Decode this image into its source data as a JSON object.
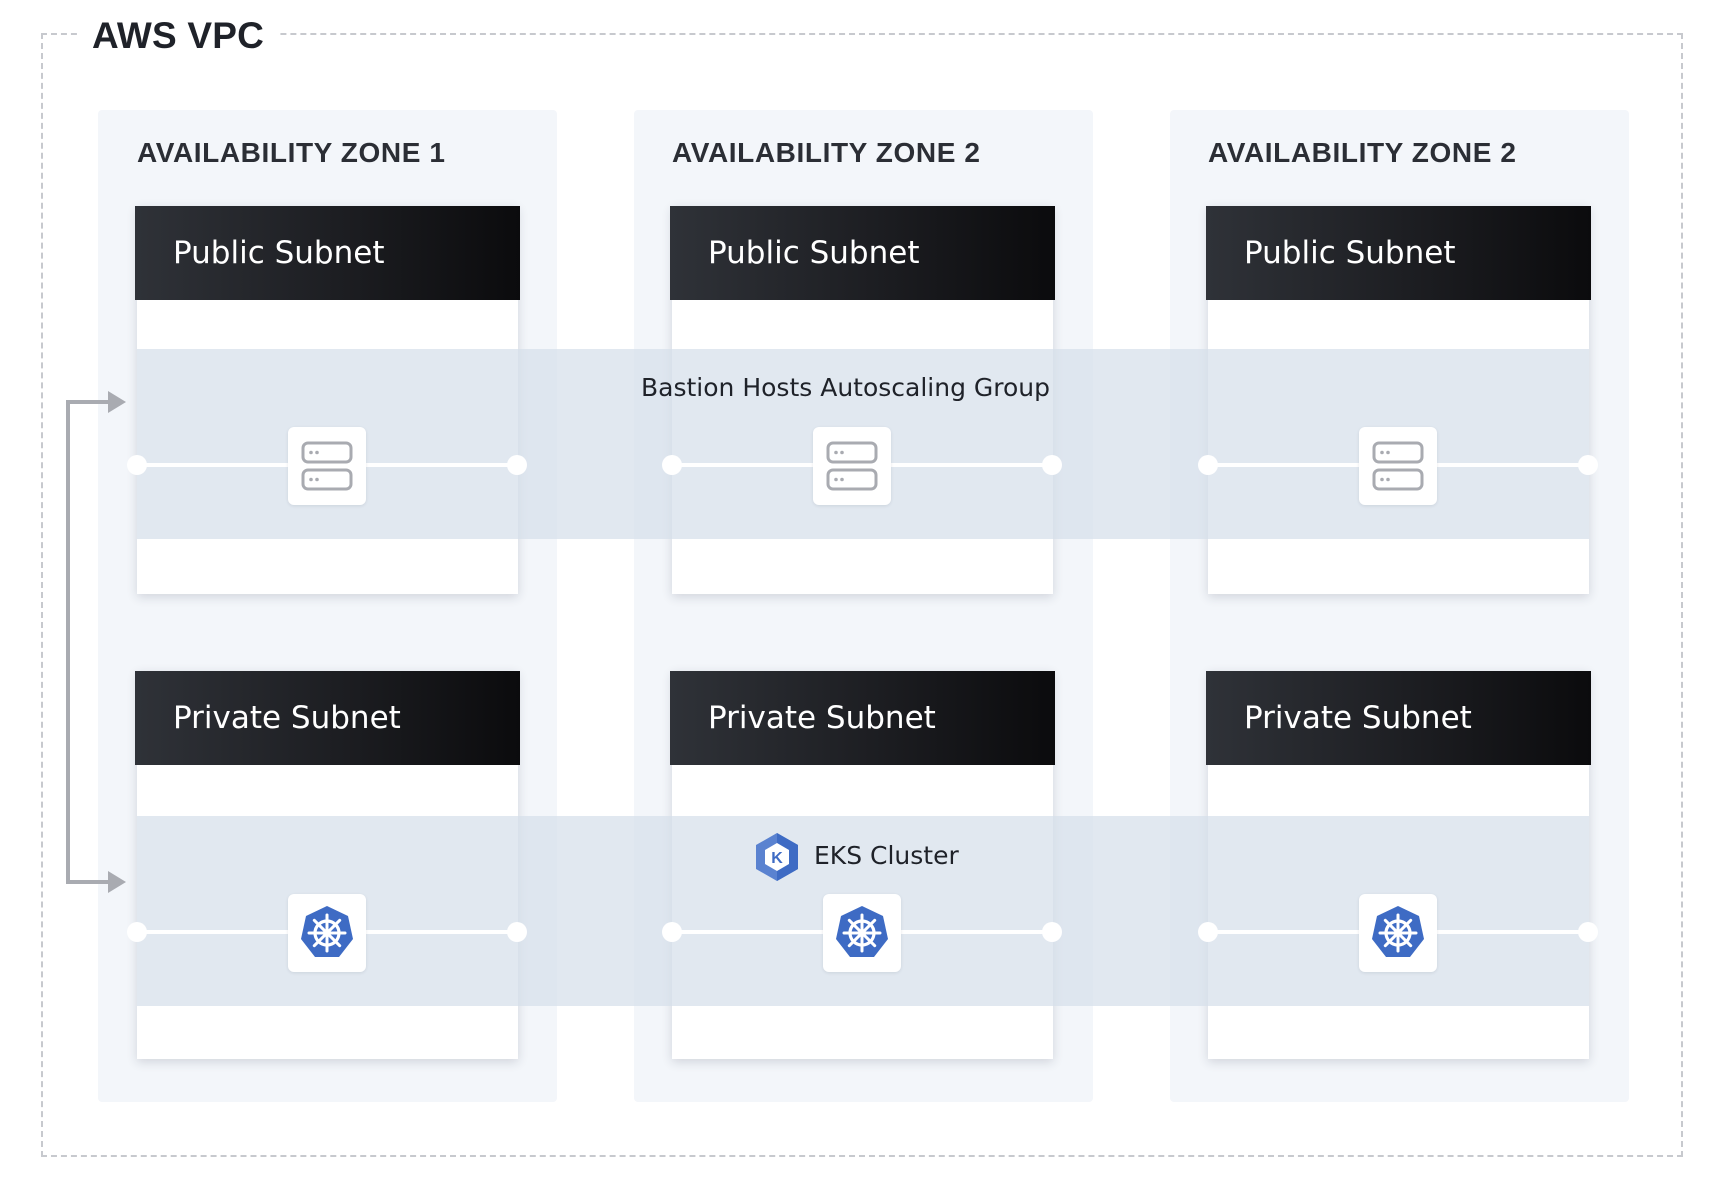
{
  "vpc": {
    "title": "AWS VPC"
  },
  "zones": [
    {
      "title": "AVAILABILITY ZONE 1",
      "public_subnet": "Public Subnet",
      "private_subnet": "Private Subnet"
    },
    {
      "title": "AVAILABILITY ZONE 2",
      "public_subnet": "Public Subnet",
      "private_subnet": "Private Subnet"
    },
    {
      "title": "AVAILABILITY ZONE 2",
      "public_subnet": "Public Subnet",
      "private_subnet": "Private Subnet"
    }
  ],
  "groups": {
    "bastion": {
      "label": "Bastion Hosts Autoscaling Group",
      "icon": "server-icon"
    },
    "eks": {
      "label": "EKS Cluster",
      "icon": "kubernetes-icon",
      "label_icon": "eks-icon"
    }
  },
  "colors": {
    "subnet_header": "#1c1d21",
    "zone_background": "#f3f6fa",
    "band_background": "#d6dfea",
    "kubernetes_blue": "#3e6bc4",
    "connector_gray": "#a9abb1"
  }
}
